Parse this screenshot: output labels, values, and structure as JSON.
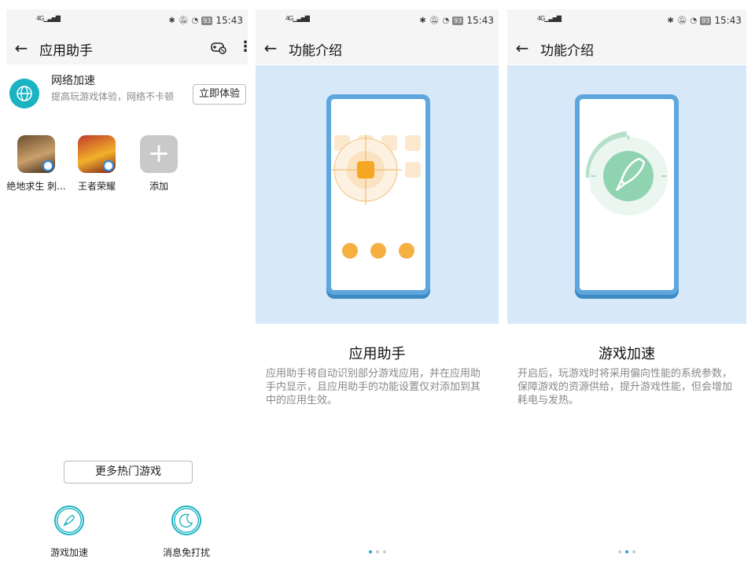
{
  "status": {
    "network": "4G",
    "battery": "93",
    "time": "15:43"
  },
  "screen1": {
    "title": "应用助手",
    "accel": {
      "title": "网络加速",
      "subtitle": "提高玩游戏体验，网络不卡顿",
      "button": "立即体验"
    },
    "games": [
      {
        "label": "绝地求生 刺..."
      },
      {
        "label": "王者荣耀"
      },
      {
        "label": "添加"
      }
    ],
    "more_button": "更多热门游戏",
    "features": [
      {
        "label": "游戏加速",
        "icon": "rocket-icon"
      },
      {
        "label": "消息免打扰",
        "icon": "moon-icon"
      }
    ]
  },
  "screen2": {
    "header": "功能介绍",
    "title": "应用助手",
    "desc": "应用助手将自动识别部分游戏应用，并在应用助手内显示，且应用助手的功能设置仅对添加到其中的应用生效。",
    "page": 1,
    "pages": 3
  },
  "screen3": {
    "header": "功能介绍",
    "title": "游戏加速",
    "desc": "开启后，玩游戏时将采用偏向性能的系统参数，保障游戏的资源供给，提升游戏性能，但会增加耗电与发热。",
    "page": 2,
    "pages": 3
  },
  "colors": {
    "accent": "#1ab3c2",
    "illustration_bg": "#d7e9f8",
    "phone_frame": "#5ea7de",
    "orange": "#f5b041",
    "green": "#7fcfa7"
  }
}
